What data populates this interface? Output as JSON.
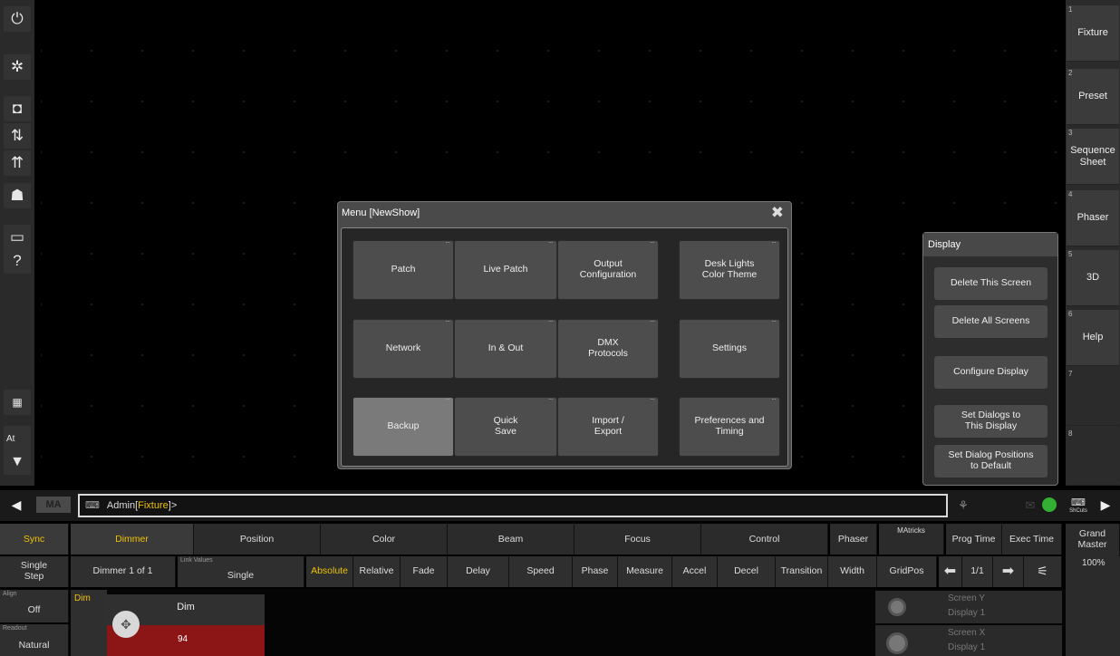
{
  "left_toolbar": {
    "at_label": "At"
  },
  "right_bar": [
    {
      "num": "1",
      "label": "Fixture"
    },
    {
      "num": "2",
      "label": "Preset"
    },
    {
      "num": "3",
      "label": "Sequence Sheet"
    },
    {
      "num": "4",
      "label": "Phaser"
    },
    {
      "num": "5",
      "label": "3D"
    },
    {
      "num": "6",
      "label": "Help"
    },
    {
      "num": "7",
      "label": ""
    },
    {
      "num": "8",
      "label": ""
    }
  ],
  "menu": {
    "title": "Menu [NewShow]",
    "buttons": [
      "Patch",
      "Live Patch",
      "Output Configuration",
      "Desk Lights Color Theme",
      "Network",
      "In & Out",
      "DMX Protocols",
      "Settings",
      "Backup",
      "Quick Save",
      "Import / Export",
      "Preferences and Timing"
    ]
  },
  "display_panel": {
    "title": "Display",
    "buttons": [
      "Delete This Screen",
      "Delete All Screens",
      "Configure Display",
      "Set Dialogs to This Display",
      "Set Dialog Positions to Default"
    ]
  },
  "command_line": {
    "ma_label": "MA",
    "prefix": "Admin[",
    "highlight": "Fixture",
    "suffix": "]>",
    "shortcuts_label": "ShCuts"
  },
  "preset_bar": {
    "sync": "Sync",
    "tabs": [
      "Dimmer",
      "Position",
      "Color",
      "Beam",
      "Focus",
      "Control"
    ],
    "phaser": "Phaser",
    "matricks": "MAtricks",
    "prog_time": "Prog Time",
    "exec_time": "Exec Time",
    "grand_master": "Grand Master",
    "grand_master_value": "100%"
  },
  "controls_bar": {
    "single_step": "Single Step",
    "dimmer_of": "Dimmer 1 of 1",
    "link_values_label": "Link Values",
    "link_values_value": "Single",
    "modes": [
      "Absolute",
      "Relative",
      "Fade",
      "Delay",
      "Speed",
      "Phase",
      "Measure",
      "Accel",
      "Decel",
      "Transition",
      "Width",
      "GridPos"
    ],
    "page": "1/1"
  },
  "bottom": {
    "align_label": "Align",
    "align_value": "Off",
    "readout_label": "Readout",
    "readout_value": "Natural",
    "dim_tab": "Dim",
    "dim_title": "Dim",
    "dim_value": "94",
    "encoders": [
      {
        "title": "Screen Y",
        "sub": "Display 1"
      },
      {
        "title": "Screen X",
        "sub": "Display 1"
      }
    ]
  }
}
